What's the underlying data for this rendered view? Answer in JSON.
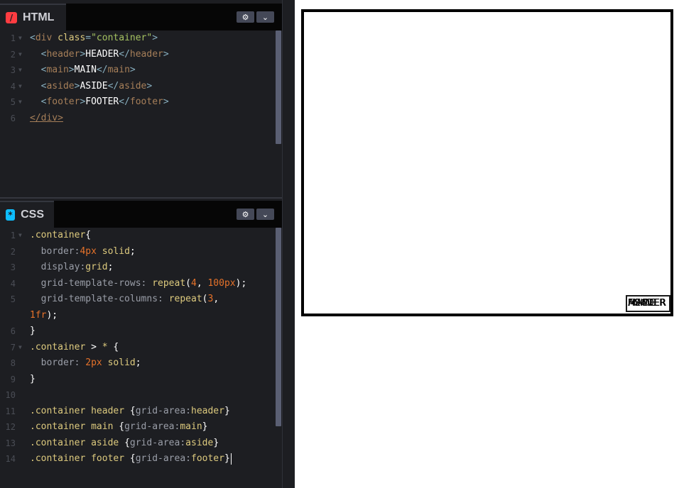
{
  "html_panel": {
    "title": "HTML",
    "icon": "slash-icon",
    "lines": [
      {
        "n": "1",
        "fold": true,
        "tokens": [
          [
            "punct",
            "<"
          ],
          [
            "tag",
            "div"
          ],
          [
            "text",
            " "
          ],
          [
            "attr",
            "class"
          ],
          [
            "punct",
            "="
          ],
          [
            "str",
            "\"container\""
          ],
          [
            "punct",
            ">"
          ]
        ]
      },
      {
        "n": "2",
        "fold": true,
        "tokens": [
          [
            "text",
            "  "
          ],
          [
            "punct",
            "<"
          ],
          [
            "tag",
            "header"
          ],
          [
            "punct",
            ">"
          ],
          [
            "text",
            "HEADER"
          ],
          [
            "punct",
            "</"
          ],
          [
            "tag",
            "header"
          ],
          [
            "punct",
            ">"
          ]
        ]
      },
      {
        "n": "3",
        "fold": true,
        "tokens": [
          [
            "text",
            "  "
          ],
          [
            "punct",
            "<"
          ],
          [
            "tag",
            "main"
          ],
          [
            "punct",
            ">"
          ],
          [
            "text",
            "MAIN"
          ],
          [
            "punct",
            "</"
          ],
          [
            "tag",
            "main"
          ],
          [
            "punct",
            ">"
          ]
        ]
      },
      {
        "n": "4",
        "fold": true,
        "tokens": [
          [
            "text",
            "  "
          ],
          [
            "punct",
            "<"
          ],
          [
            "tag",
            "aside"
          ],
          [
            "punct",
            ">"
          ],
          [
            "text",
            "ASIDE"
          ],
          [
            "punct",
            "</"
          ],
          [
            "tag",
            "aside"
          ],
          [
            "punct",
            ">"
          ]
        ]
      },
      {
        "n": "5",
        "fold": true,
        "tokens": [
          [
            "text",
            "  "
          ],
          [
            "punct",
            "<"
          ],
          [
            "tag",
            "footer"
          ],
          [
            "punct",
            ">"
          ],
          [
            "text",
            "FOOTER"
          ],
          [
            "punct",
            "</"
          ],
          [
            "tag",
            "footer"
          ],
          [
            "punct",
            ">"
          ]
        ]
      },
      {
        "n": "6",
        "fold": false,
        "tokens": [
          [
            "tagu",
            "</div>"
          ]
        ]
      }
    ]
  },
  "css_panel": {
    "title": "CSS",
    "icon": "asterisk-icon",
    "lines": [
      {
        "n": "1",
        "fold": true,
        "tokens": [
          [
            "sel",
            ".container"
          ],
          [
            "brace",
            "{"
          ]
        ]
      },
      {
        "n": "2",
        "fold": false,
        "tokens": [
          [
            "text",
            "  "
          ],
          [
            "prop",
            "border"
          ],
          [
            "prop",
            ":"
          ],
          [
            "num",
            "4px"
          ],
          [
            "text",
            " "
          ],
          [
            "val",
            "solid"
          ],
          [
            "brace",
            ";"
          ]
        ]
      },
      {
        "n": "3",
        "fold": false,
        "tokens": [
          [
            "text",
            "  "
          ],
          [
            "prop",
            "display"
          ],
          [
            "prop",
            ":"
          ],
          [
            "val",
            "grid"
          ],
          [
            "brace",
            ";"
          ]
        ]
      },
      {
        "n": "4",
        "fold": false,
        "tokens": [
          [
            "text",
            "  "
          ],
          [
            "prop",
            "grid-template-rows"
          ],
          [
            "prop",
            ": "
          ],
          [
            "val",
            "repeat"
          ],
          [
            "brace",
            "("
          ],
          [
            "num",
            "4"
          ],
          [
            "brace",
            ", "
          ],
          [
            "num",
            "100px"
          ],
          [
            "brace",
            ");"
          ]
        ]
      },
      {
        "n": "5",
        "fold": false,
        "tokens": [
          [
            "text",
            "  "
          ],
          [
            "prop",
            "grid-template-columns"
          ],
          [
            "prop",
            ": "
          ],
          [
            "val",
            "repeat"
          ],
          [
            "brace",
            "("
          ],
          [
            "num",
            "3"
          ],
          [
            "brace",
            ","
          ]
        ]
      },
      {
        "n": "",
        "fold": false,
        "tokens": [
          [
            "num",
            "1fr"
          ],
          [
            "brace",
            ");"
          ]
        ]
      },
      {
        "n": "6",
        "fold": false,
        "tokens": [
          [
            "brace",
            "}"
          ]
        ]
      },
      {
        "n": "7",
        "fold": true,
        "tokens": [
          [
            "sel",
            ".container"
          ],
          [
            "text",
            " "
          ],
          [
            "brace",
            ">"
          ],
          [
            "text",
            " "
          ],
          [
            "sel",
            "*"
          ],
          [
            "text",
            " "
          ],
          [
            "brace",
            "{"
          ]
        ]
      },
      {
        "n": "8",
        "fold": false,
        "tokens": [
          [
            "text",
            "  "
          ],
          [
            "prop",
            "border"
          ],
          [
            "prop",
            ": "
          ],
          [
            "num",
            "2px"
          ],
          [
            "text",
            " "
          ],
          [
            "val",
            "solid"
          ],
          [
            "brace",
            ";"
          ]
        ]
      },
      {
        "n": "9",
        "fold": false,
        "tokens": [
          [
            "brace",
            "}"
          ]
        ]
      },
      {
        "n": "10",
        "fold": false,
        "tokens": []
      },
      {
        "n": "11",
        "fold": false,
        "tokens": [
          [
            "sel",
            ".container header"
          ],
          [
            "text",
            " "
          ],
          [
            "brace",
            "{"
          ],
          [
            "prop",
            "grid-area"
          ],
          [
            "prop",
            ":"
          ],
          [
            "val",
            "header"
          ],
          [
            "brace",
            "}"
          ]
        ]
      },
      {
        "n": "12",
        "fold": false,
        "tokens": [
          [
            "sel",
            ".container main"
          ],
          [
            "text",
            " "
          ],
          [
            "brace",
            "{"
          ],
          [
            "prop",
            "grid-area"
          ],
          [
            "prop",
            ":"
          ],
          [
            "val",
            "main"
          ],
          [
            "brace",
            "}"
          ]
        ]
      },
      {
        "n": "13",
        "fold": false,
        "tokens": [
          [
            "sel",
            ".container aside"
          ],
          [
            "text",
            " "
          ],
          [
            "brace",
            "{"
          ],
          [
            "prop",
            "grid-area"
          ],
          [
            "prop",
            ":"
          ],
          [
            "val",
            "aside"
          ],
          [
            "brace",
            "}"
          ]
        ]
      },
      {
        "n": "14",
        "fold": false,
        "cursor": true,
        "tokens": [
          [
            "sel",
            ".container footer"
          ],
          [
            "text",
            " "
          ],
          [
            "brace",
            "{"
          ],
          [
            "prop",
            "grid-area"
          ],
          [
            "prop",
            ":"
          ],
          [
            "val",
            "footer"
          ],
          [
            "brace",
            "}"
          ]
        ]
      }
    ]
  },
  "panel_buttons": {
    "settings_icon": "gear-icon",
    "settings_glyph": "⚙",
    "collapse_icon": "chevron-down-icon",
    "collapse_glyph": "⌄"
  },
  "preview": {
    "items": [
      "HEADER",
      "MAIN",
      "ASIDE",
      "FOOTER"
    ]
  },
  "colors": {
    "editor_bg": "#1d1e22",
    "header_bg": "#060606",
    "html_accent": "#ff3c41",
    "css_accent": "#0ebeff",
    "tag": "#a67f59",
    "attr_value": "#ddca7e",
    "string": "#a5c261",
    "number": "#e6722a"
  }
}
